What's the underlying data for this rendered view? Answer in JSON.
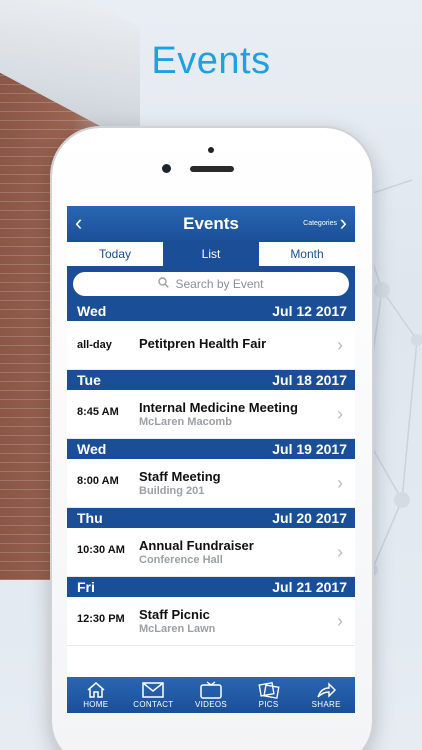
{
  "promo": {
    "title": "Events"
  },
  "navbar": {
    "title": "Events",
    "categories_label": "Categories",
    "back_icon": "chevron-left-icon",
    "forward_icon": "chevron-right-icon"
  },
  "segments": {
    "today": "Today",
    "list": "List",
    "month": "Month",
    "selected": "List"
  },
  "search": {
    "placeholder": "Search by Event"
  },
  "days": [
    {
      "day": "Wed",
      "date": "Jul 12 2017",
      "events": [
        {
          "time": "all-day",
          "name": "Petitpren Health Fair",
          "location": ""
        }
      ]
    },
    {
      "day": "Tue",
      "date": "Jul 18 2017",
      "events": [
        {
          "time": "8:45 AM",
          "name": "Internal Medicine Meeting",
          "location": "McLaren Macomb"
        }
      ]
    },
    {
      "day": "Wed",
      "date": "Jul 19 2017",
      "events": [
        {
          "time": "8:00 AM",
          "name": "Staff Meeting",
          "location": "Building 201"
        }
      ]
    },
    {
      "day": "Thu",
      "date": "Jul 20 2017",
      "events": [
        {
          "time": "10:30 AM",
          "name": "Annual Fundraiser",
          "location": "Conference Hall"
        }
      ]
    },
    {
      "day": "Fri",
      "date": "Jul 21 2017",
      "events": [
        {
          "time": "12:30 PM",
          "name": "Staff Picnic",
          "location": "McLaren Lawn"
        }
      ]
    }
  ],
  "tabbar": [
    {
      "label": "HOME",
      "icon": "home-icon"
    },
    {
      "label": "CONTACT",
      "icon": "envelope-icon"
    },
    {
      "label": "VIDEOS",
      "icon": "tv-icon"
    },
    {
      "label": "PICS",
      "icon": "photos-icon"
    },
    {
      "label": "SHARE",
      "icon": "share-icon"
    }
  ],
  "colors": {
    "brand_blue": "#1a4f97",
    "accent_cyan": "#1da1e0"
  }
}
